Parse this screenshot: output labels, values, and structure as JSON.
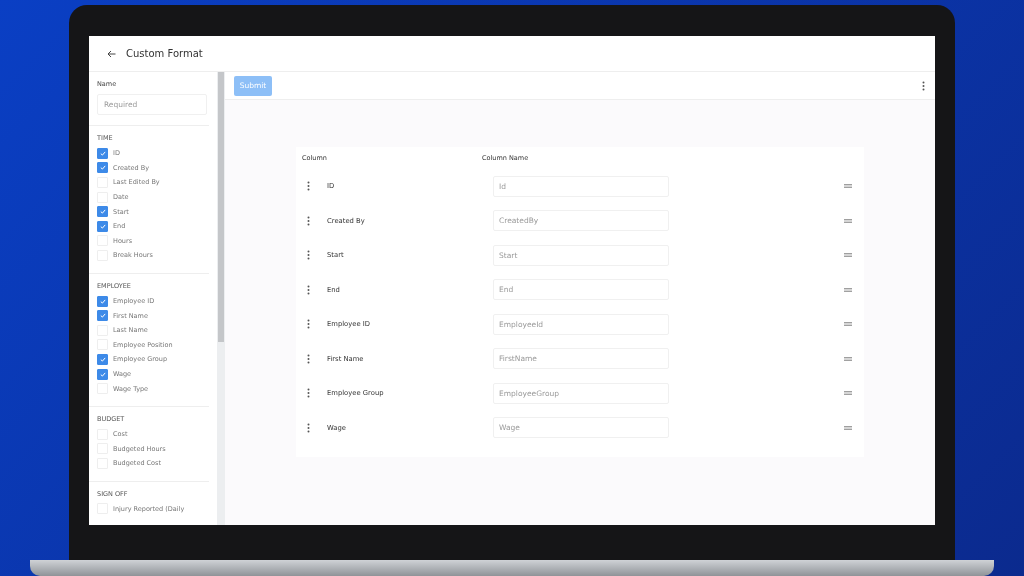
{
  "header": {
    "title": "Custom Format"
  },
  "name_field": {
    "label": "Name",
    "placeholder": "Required"
  },
  "sections": [
    {
      "title": "TIME",
      "items": [
        {
          "label": "ID",
          "checked": true
        },
        {
          "label": "Created By",
          "checked": true
        },
        {
          "label": "Last Edited By",
          "checked": false
        },
        {
          "label": "Date",
          "checked": false
        },
        {
          "label": "Start",
          "checked": true
        },
        {
          "label": "End",
          "checked": true
        },
        {
          "label": "Hours",
          "checked": false
        },
        {
          "label": "Break Hours",
          "checked": false
        }
      ]
    },
    {
      "title": "EMPLOYEE",
      "items": [
        {
          "label": "Employee ID",
          "checked": true
        },
        {
          "label": "First Name",
          "checked": true
        },
        {
          "label": "Last Name",
          "checked": false
        },
        {
          "label": "Employee Position",
          "checked": false
        },
        {
          "label": "Employee Group",
          "checked": true
        },
        {
          "label": "Wage",
          "checked": true
        },
        {
          "label": "Wage Type",
          "checked": false
        }
      ]
    },
    {
      "title": "BUDGET",
      "items": [
        {
          "label": "Cost",
          "checked": false
        },
        {
          "label": "Budgeted Hours",
          "checked": false
        },
        {
          "label": "Budgeted Cost",
          "checked": false
        }
      ]
    },
    {
      "title": "SIGN OFF",
      "items": [
        {
          "label": "Injury Reported (Daily",
          "checked": false
        }
      ]
    }
  ],
  "toolbar": {
    "submit": {
      "label": "Submit",
      "disabled": true
    }
  },
  "table": {
    "columns": [
      "Column",
      "Column Name"
    ],
    "rows": [
      {
        "column": "ID",
        "placeholder": "Id"
      },
      {
        "column": "Created By",
        "placeholder": "CreatedBy"
      },
      {
        "column": "Start",
        "placeholder": "Start"
      },
      {
        "column": "End",
        "placeholder": "End"
      },
      {
        "column": "Employee ID",
        "placeholder": "EmployeeId"
      },
      {
        "column": "First Name",
        "placeholder": "FirstName"
      },
      {
        "column": "Employee Group",
        "placeholder": "EmployeeGroup"
      },
      {
        "column": "Wage",
        "placeholder": "Wage"
      }
    ]
  }
}
